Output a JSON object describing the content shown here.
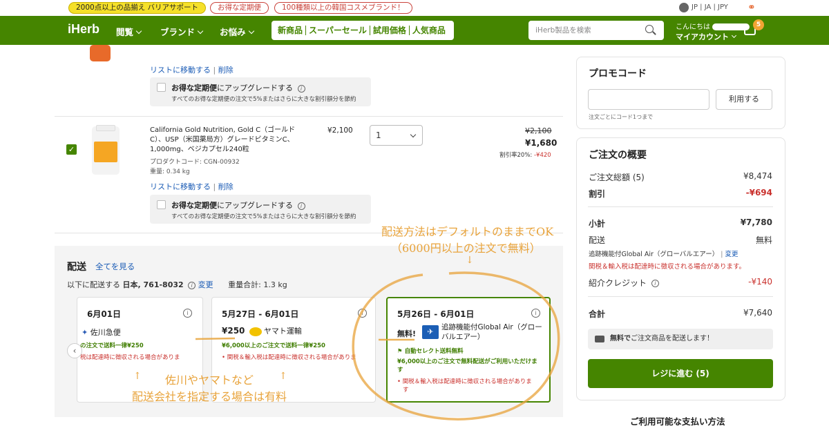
{
  "topbar": {
    "promo1": "2000点以上の品揃え バリアサポート",
    "promo2": "お得な定期便",
    "promo3": "100種類以上の韓国コスメブランド！",
    "locale": "JP | JA | JPY",
    "globe_icon": "globe-icon",
    "share_icon": "share-icon"
  },
  "nav": {
    "logo": "iHerb",
    "menu1": "閲覧",
    "menu2": "ブランド",
    "menu3": "お悩み",
    "links": [
      "新商品",
      "スーパーセール",
      "試用価格",
      "人気商品"
    ],
    "search_placeholder": "iHerb製品を検索",
    "greeting": "こんにちは",
    "account": "マイアカウント",
    "cart_count": "5"
  },
  "item1": {
    "move_link": "リストに移動する",
    "delete_link": "削除",
    "upgrade_title_bold": "お得な定期便",
    "upgrade_title_rest": "にアップグレードする",
    "upgrade_sub": "すべてのお得な定期便の注文で5%またはさらに大きな割引額分を節約"
  },
  "item2": {
    "name_line1": "California Gold Nutrition, Gold C（ゴールド",
    "name_line2": "C）、USP（米国薬局方）グレードビタミンC、",
    "name_line3": "1,000mg、ベジカプセル240粒",
    "code": "プロダクトコード: CGN-00932",
    "weight": "重量: 0.34 kg",
    "unit_price": "¥2,100",
    "qty": "1",
    "orig_price": "¥2,100",
    "price": "¥1,680",
    "discount_label": "割引率20%: ",
    "discount_value": "-¥420",
    "move_link": "リストに移動する",
    "delete_link": "削除",
    "upgrade_title_bold": "お得な定期便",
    "upgrade_title_rest": "にアップグレードする",
    "upgrade_sub": "すべてのお得な定期便の注文で5%またはさらに大きな割引額分を節約"
  },
  "shipping": {
    "title": "配送",
    "see_all": "全てを見る",
    "dest_prefix": "以下に配送する",
    "dest": "日本, 761-8032",
    "change": "変更",
    "weight": "重量合計: 1.3 kg",
    "cards": [
      {
        "date": "6月01日",
        "carrier": "佐川急便",
        "free_note": "の注文で送料一律¥250",
        "tax_note": "税は配達時に徴収される場合がありま"
      },
      {
        "date": "5月27日 - 6月01日",
        "price": "¥250",
        "carrier": "ヤマト運輸",
        "free_note": "¥6,000以上のご注文で送料一律¥250",
        "tax_note": "関税＆輸入税は配達時に徴収される場合がありま"
      },
      {
        "date": "5月26日 - 6月01日",
        "price": "無料!",
        "carrier_line1": "追跡機能付Global Air（グロー",
        "carrier_line2": "バルエアー）",
        "tag": "自動セレクト送料無料",
        "free_note_line1": "¥6,000以上のご注文で無料配送がご利用いただけま",
        "free_note_line2": "す",
        "tax_note": "関税＆輸入税は配達時に徴収される場合がありま",
        "tax_note2": "す"
      }
    ]
  },
  "annotations": {
    "top1": "配送方法はデフォルトのままでOK",
    "top2": "（6000円以上の注文で無料）",
    "arrow_down": "↓",
    "bottom_arrow": "↑",
    "bottom1": "佐川やヤマトなど",
    "bottom2": "配送会社を指定する場合は有料"
  },
  "promo": {
    "title": "プロモコード",
    "apply": "利用する",
    "note": "注文ごとにコード1つまで"
  },
  "summary": {
    "title": "ご注文の概要",
    "total_items_label": "ご注文総額 (5)",
    "total_items": "¥8,474",
    "discount_label": "割引",
    "discount": "-¥694",
    "subtotal_label": "小計",
    "subtotal": "¥7,780",
    "shipping_label": "配送",
    "shipping": "無料",
    "method": "追跡機能付Global Air（グローバルエアー）",
    "method_change": "変更",
    "tax_note": "関税＆輸入税は配達時に徴収される場合があります。",
    "credit_label": "紹介クレジット",
    "credit": "-¥140",
    "grand_label": "合計",
    "grand": "¥7,640",
    "banner_bold": "無料で",
    "banner_rest": "ご注文商品を配送します！",
    "checkout": "レジに進む (5)",
    "payment_title": "ご利用可能な支払い方法"
  }
}
